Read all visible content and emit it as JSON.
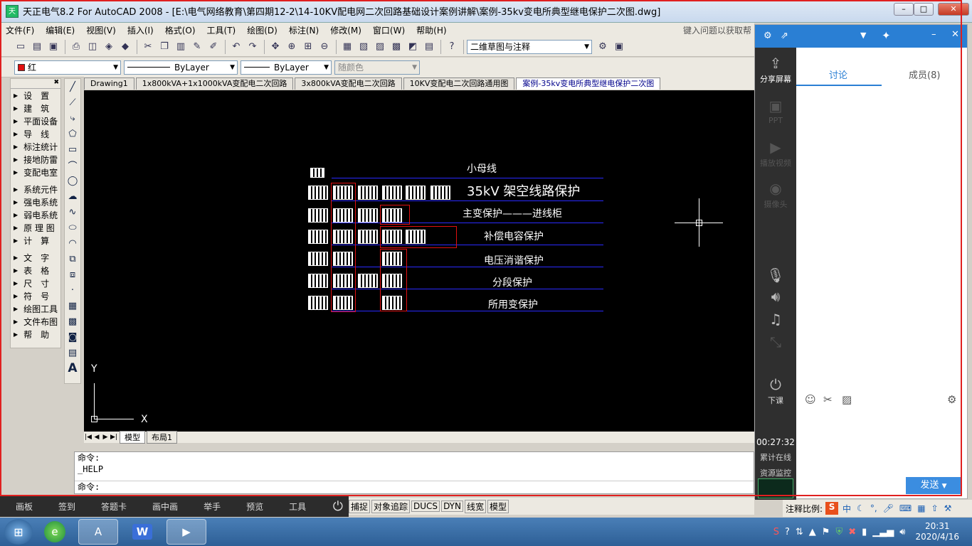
{
  "window": {
    "title": "天正电气8.2 For AutoCAD 2008 - [E:\\电气网络教育\\第四期12-2\\14-10KV配电网二次回路基础设计案例讲解\\案例-35kv变电所典型继电保护二次图.dwg]",
    "app_icon": "天",
    "min_label": "–",
    "max_label": "□",
    "close_label": "✕"
  },
  "menu": {
    "items": [
      "文件(F)",
      "编辑(E)",
      "视图(V)",
      "插入(I)",
      "格式(O)",
      "工具(T)",
      "绘图(D)",
      "标注(N)",
      "修改(M)",
      "窗口(W)",
      "帮助(H)"
    ],
    "help_search": "键入问题以获取帮"
  },
  "toolbar": {
    "workspace": "二维草图与注释",
    "color": "红",
    "color_hex": "#e01010",
    "linetype": "ByLayer",
    "lineweight": "ByLayer",
    "plotstyle": "随颜色"
  },
  "left_panel": {
    "group1": [
      "设　置",
      "建　筑",
      "平面设备",
      "导　线",
      "标注统计",
      "接地防雷",
      "变配电室"
    ],
    "group2": [
      "系统元件",
      "强电系统",
      "弱电系统",
      "原 理 图",
      "计　算"
    ],
    "group3": [
      "文　字",
      "表　格",
      "尺　寸",
      "符　号",
      "绘图工具",
      "文件布图",
      "帮　助"
    ]
  },
  "doc_tabs": [
    "Drawing1",
    "1x800kVA+1x1000kVA变配电二次回路",
    "3x800kVA变配电二次回路",
    "10KV变配电二次回路通用图",
    "案例-35kv变电所典型继电保护二次图"
  ],
  "drawing": {
    "labels": [
      "小母线",
      "35kV 架空线路保护",
      "主变保护———进线柜",
      "补偿电容保护",
      "电压消谐保护",
      "分段保护",
      "所用变保护"
    ],
    "ucs_x": "X",
    "ucs_y": "Y"
  },
  "model_tabs": [
    "模型",
    "布局1"
  ],
  "command": {
    "line1": "命令:",
    "line2": "_HELP",
    "prompt": "命令:"
  },
  "status": {
    "left_items": [
      "画板",
      "签到",
      "答题卡",
      "画中画",
      "举手",
      "预览",
      "工具"
    ],
    "buttons": [
      "捕捉",
      "对象追踪",
      "DUCS",
      "DYN",
      "线宽",
      "模型"
    ],
    "annotation_scale": "注释比例:"
  },
  "side_panel": {
    "tab_discussion": "讨论",
    "tab_members": "成员(8)",
    "share_screen": "分享屏幕",
    "ppt": "PPT",
    "play_video": "播放视频",
    "camera": "摄像头",
    "end_class": "下课",
    "timer": "00:27:32",
    "cumulative": "累计在线",
    "resource_monitor": "资源监控",
    "send": "发送"
  },
  "taskbar": {
    "time": "20:31",
    "date": "2020/4/16",
    "ime": "中"
  }
}
